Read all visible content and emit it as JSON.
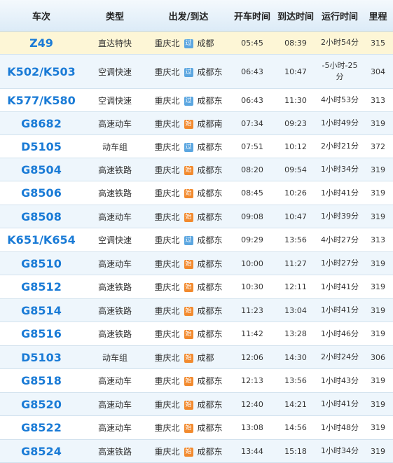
{
  "headers": {
    "train": "车次",
    "type": "类型",
    "route": "出发/到达",
    "depart": "开车时间",
    "arrive": "到达时间",
    "duration": "运行时间",
    "distance": "里程"
  },
  "badges": {
    "pass": "过",
    "start": "始"
  },
  "colors": {
    "train_text": "#1a7bd6",
    "badge_pass": "#5ba6e0",
    "badge_start": "#f28a2e",
    "highlight_row": "#fdf6d6",
    "alt_row": "#eef6fc"
  },
  "rows": [
    {
      "train": "Z49",
      "type": "直达特快",
      "from": "重庆北",
      "badge": "过",
      "to": "成都",
      "depart": "05:45",
      "arrive": "08:39",
      "duration": "2小时54分",
      "distance": "315"
    },
    {
      "train": "K502/K503",
      "type": "空调快速",
      "from": "重庆北",
      "badge": "过",
      "to": "成都东",
      "depart": "06:43",
      "arrive": "10:47",
      "duration": "-5小时-25分",
      "distance": "304"
    },
    {
      "train": "K577/K580",
      "type": "空调快速",
      "from": "重庆北",
      "badge": "过",
      "to": "成都东",
      "depart": "06:43",
      "arrive": "11:30",
      "duration": "4小时53分",
      "distance": "313"
    },
    {
      "train": "G8682",
      "type": "高速动车",
      "from": "重庆北",
      "badge": "始",
      "to": "成都南",
      "depart": "07:34",
      "arrive": "09:23",
      "duration": "1小时49分",
      "distance": "319"
    },
    {
      "train": "D5105",
      "type": "动车组",
      "from": "重庆北",
      "badge": "过",
      "to": "成都东",
      "depart": "07:51",
      "arrive": "10:12",
      "duration": "2小时21分",
      "distance": "372"
    },
    {
      "train": "G8504",
      "type": "高速铁路",
      "from": "重庆北",
      "badge": "始",
      "to": "成都东",
      "depart": "08:20",
      "arrive": "09:54",
      "duration": "1小时34分",
      "distance": "319"
    },
    {
      "train": "G8506",
      "type": "高速铁路",
      "from": "重庆北",
      "badge": "始",
      "to": "成都东",
      "depart": "08:45",
      "arrive": "10:26",
      "duration": "1小时41分",
      "distance": "319"
    },
    {
      "train": "G8508",
      "type": "高速动车",
      "from": "重庆北",
      "badge": "始",
      "to": "成都东",
      "depart": "09:08",
      "arrive": "10:47",
      "duration": "1小时39分",
      "distance": "319"
    },
    {
      "train": "K651/K654",
      "type": "空调快速",
      "from": "重庆北",
      "badge": "过",
      "to": "成都东",
      "depart": "09:29",
      "arrive": "13:56",
      "duration": "4小时27分",
      "distance": "313"
    },
    {
      "train": "G8510",
      "type": "高速动车",
      "from": "重庆北",
      "badge": "始",
      "to": "成都东",
      "depart": "10:00",
      "arrive": "11:27",
      "duration": "1小时27分",
      "distance": "319"
    },
    {
      "train": "G8512",
      "type": "高速铁路",
      "from": "重庆北",
      "badge": "始",
      "to": "成都东",
      "depart": "10:30",
      "arrive": "12:11",
      "duration": "1小时41分",
      "distance": "319"
    },
    {
      "train": "G8514",
      "type": "高速铁路",
      "from": "重庆北",
      "badge": "始",
      "to": "成都东",
      "depart": "11:23",
      "arrive": "13:04",
      "duration": "1小时41分",
      "distance": "319"
    },
    {
      "train": "G8516",
      "type": "高速铁路",
      "from": "重庆北",
      "badge": "始",
      "to": "成都东",
      "depart": "11:42",
      "arrive": "13:28",
      "duration": "1小时46分",
      "distance": "319"
    },
    {
      "train": "D5103",
      "type": "动车组",
      "from": "重庆北",
      "badge": "始",
      "to": "成都",
      "depart": "12:06",
      "arrive": "14:30",
      "duration": "2小时24分",
      "distance": "306"
    },
    {
      "train": "G8518",
      "type": "高速动车",
      "from": "重庆北",
      "badge": "始",
      "to": "成都东",
      "depart": "12:13",
      "arrive": "13:56",
      "duration": "1小时43分",
      "distance": "319"
    },
    {
      "train": "G8520",
      "type": "高速动车",
      "from": "重庆北",
      "badge": "始",
      "to": "成都东",
      "depart": "12:40",
      "arrive": "14:21",
      "duration": "1小时41分",
      "distance": "319"
    },
    {
      "train": "G8522",
      "type": "高速动车",
      "from": "重庆北",
      "badge": "始",
      "to": "成都东",
      "depart": "13:08",
      "arrive": "14:56",
      "duration": "1小时48分",
      "distance": "319"
    },
    {
      "train": "G8524",
      "type": "高速铁路",
      "from": "重庆北",
      "badge": "始",
      "to": "成都东",
      "depart": "13:44",
      "arrive": "15:18",
      "duration": "1小时34分",
      "distance": "319"
    }
  ]
}
